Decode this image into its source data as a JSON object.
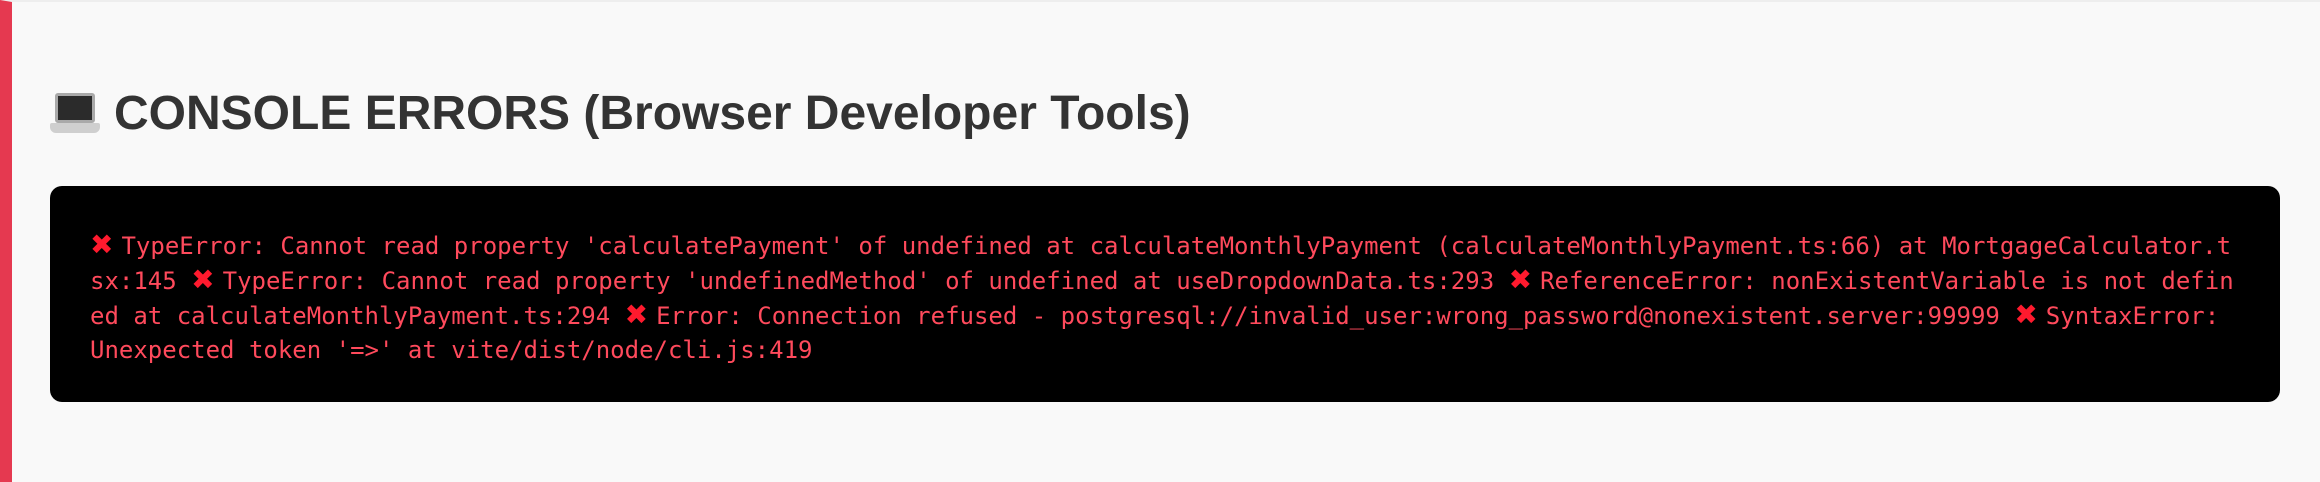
{
  "section": {
    "title": "CONSOLE ERRORS (Browser Developer Tools)",
    "icon": "laptop-icon"
  },
  "console": {
    "error_icon": "✖",
    "errors": [
      "TypeError: Cannot read property 'calculatePayment' of undefined at calculateMonthlyPayment (calculateMonthlyPayment.ts:66) at MortgageCalculator.tsx:145",
      "TypeError: Cannot read property 'undefinedMethod' of undefined at useDropdownData.ts:293",
      "ReferenceError: nonExistentVariable is not defined at calculateMonthlyPayment.ts:294",
      "Error: Connection refused - postgresql://invalid_user:wrong_password@nonexistent.server:99999",
      "SyntaxError: Unexpected token '=>' at vite/dist/node/cli.js:419"
    ]
  },
  "colors": {
    "accent_border": "#e53950",
    "error_text": "#ff4a5c",
    "console_background": "#000000"
  }
}
